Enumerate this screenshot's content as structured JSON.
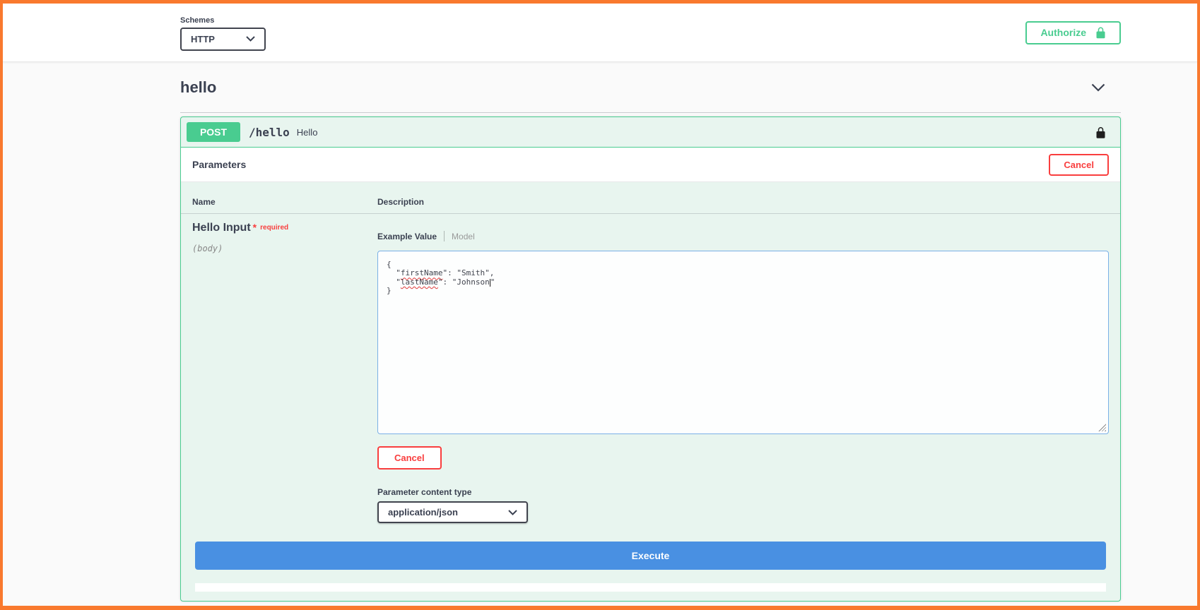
{
  "topbar": {
    "schemes_label": "Schemes",
    "scheme_selected": "HTTP",
    "authorize_label": "Authorize"
  },
  "tag": {
    "name": "hello"
  },
  "operation": {
    "method": "POST",
    "path": "/hello",
    "summary": "Hello",
    "parameters_title": "Parameters",
    "cancel_label": "Cancel",
    "table": {
      "name_header": "Name",
      "description_header": "Description"
    },
    "param": {
      "name": "Hello Input",
      "required_star": "*",
      "required_label": "required",
      "location": "(body)",
      "tabs": {
        "example": "Example Value",
        "model": "Model"
      },
      "body_editor": {
        "line1": "{",
        "line2_open": "  \"",
        "line2_key": "firstName",
        "line2_rest": "\": \"Smith\",",
        "line3_open": "  \"",
        "line3_key": "lastName",
        "line3_rest": "\": \"Johnson",
        "line3_end": "\"",
        "line4": "}"
      },
      "cancel_label": "Cancel",
      "content_type_label": "Parameter content type",
      "content_type_value": "application/json"
    },
    "execute_label": "Execute"
  },
  "colors": {
    "frame_orange": "#f9792e",
    "post_green": "#49cc90",
    "panel_bg": "#e8f5ef",
    "cancel_red": "#f93e3e",
    "execute_blue": "#4990e2",
    "textarea_border": "#7ab0e6",
    "text_dark": "#3b4151"
  }
}
